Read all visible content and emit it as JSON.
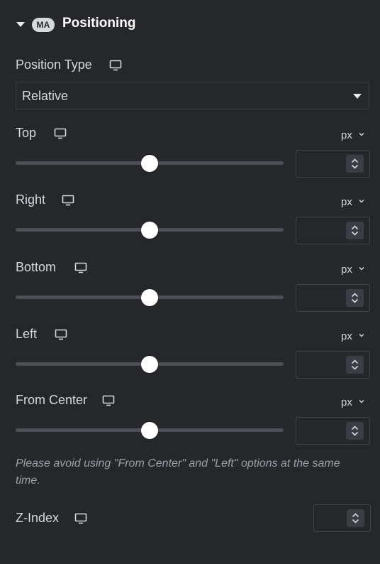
{
  "section": {
    "title": "Positioning",
    "badge": "MA",
    "collapse_icon": "caret-down-icon"
  },
  "position_type": {
    "label": "Position Type",
    "device_icon": "desktop-icon",
    "selected": "Relative"
  },
  "controls": [
    {
      "label": "Top",
      "unit": "px",
      "slider_percent": 50,
      "value": ""
    },
    {
      "label": "Right",
      "unit": "px",
      "slider_percent": 50,
      "value": ""
    },
    {
      "label": "Bottom",
      "unit": "px",
      "slider_percent": 50,
      "value": ""
    },
    {
      "label": "Left",
      "unit": "px",
      "slider_percent": 50,
      "value": ""
    },
    {
      "label": "From Center",
      "unit": "px",
      "slider_percent": 50,
      "value": ""
    }
  ],
  "note": "Please avoid using \"From Center\" and \"Left\" options at the same time.",
  "z_index": {
    "label": "Z-Index",
    "value": ""
  },
  "colors": {
    "background": "#26272b",
    "text": "#d5d8dc",
    "border": "#3f444b",
    "track": "#4c4f55",
    "thumb": "#ffffff"
  }
}
